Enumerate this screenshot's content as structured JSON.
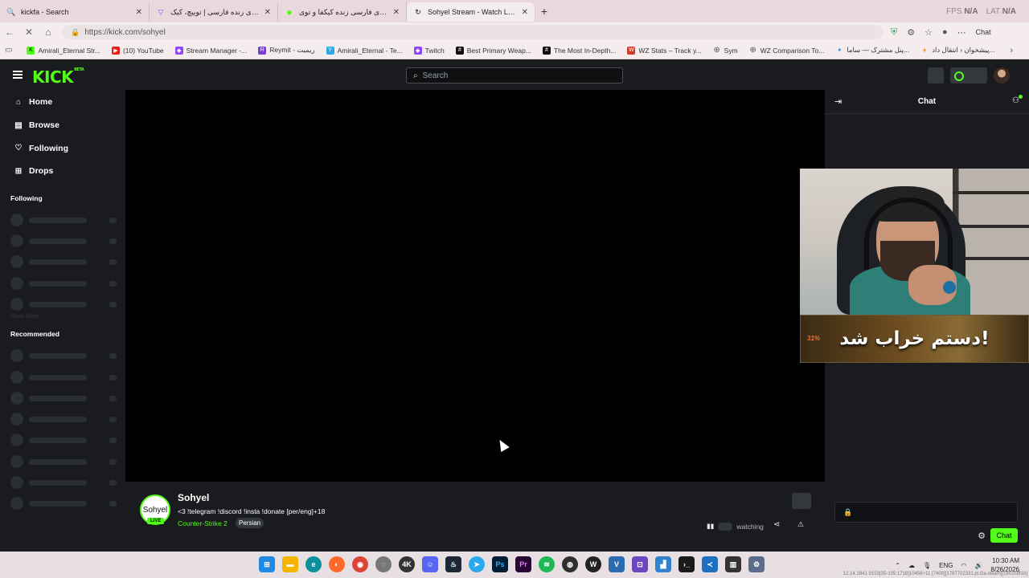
{
  "browser": {
    "tabs": [
      {
        "title": "kickfa - Search",
        "icon": "search-icon",
        "color": "#6a5acd"
      },
      {
        "title": "استریم‌های زنده فارسی | توییچ، کیک",
        "icon": "twitch-icon",
        "color": "#9146ff"
      },
      {
        "title": "استریمرهای فارسی زنده کیکفا و توی",
        "icon": "kickfa-icon",
        "color": "#53fc18"
      },
      {
        "title": "Sohyel Stream - Watch Live on Kick",
        "icon": "kick-icon",
        "color": "#53fc18"
      }
    ],
    "fps_label": "FPS",
    "fps_value": "N/A",
    "lat_label": "LAT",
    "lat_value": "N/A",
    "url": "https://kick.com/sohyel",
    "chat_label": "Chat",
    "bookmarks": [
      {
        "label": "Amirali_Eternal Str...",
        "color": "#53fc18",
        "icon": "K"
      },
      {
        "label": "(10) YouTube",
        "color": "#e62117",
        "icon": "▶"
      },
      {
        "label": "Stream Manager -...",
        "color": "#9146ff",
        "icon": "◆"
      },
      {
        "label": "Reymit - ریمیت",
        "color": "#7a3fd1",
        "icon": "R"
      },
      {
        "label": "Amirali_Eternal - Te...",
        "color": "#29a9eb",
        "icon": "Y"
      },
      {
        "label": "Twitch",
        "color": "#9146ff",
        "icon": "◆"
      },
      {
        "label": "Best Primary Weap...",
        "color": "#111111",
        "icon": "#"
      },
      {
        "label": "The Most In-Depth...",
        "color": "#111111",
        "icon": "#"
      },
      {
        "label": "WZ Stats – Track y...",
        "color": "#d23b2b",
        "icon": "W"
      },
      {
        "label": "Sym",
        "color": "#555555",
        "icon": "⊕"
      },
      {
        "label": "WZ Comparison To...",
        "color": "#555555",
        "icon": "⊕"
      },
      {
        "label": "پنل مشترک — ساما...",
        "color": "#2d8ff0",
        "icon": "●"
      },
      {
        "label": "پیشخوان ‹ انتقال داد...",
        "color": "#e07b00",
        "icon": "✈"
      }
    ]
  },
  "kick": {
    "logo": "KICK",
    "beta": "BETA",
    "search_placeholder": "Search",
    "nav": [
      {
        "label": "Home",
        "icon": "home-icon"
      },
      {
        "label": "Browse",
        "icon": "browse-icon"
      },
      {
        "label": "Following",
        "icon": "heart-icon"
      },
      {
        "label": "Drops",
        "icon": "drops-icon"
      }
    ],
    "following_title": "Following",
    "show_more": "Show More",
    "recommended_title": "Recommended",
    "accent": "#53fc18",
    "channel": {
      "avatar_text": "Sohyel",
      "live_badge": "LIVE",
      "name": "Sohyel",
      "title": "<3 !telegram !discord !insta !donate  [per/eng]+18",
      "category": "Counter-Strike 2",
      "tag": "Persian",
      "watching": "watching"
    },
    "chat": {
      "title": "Chat",
      "send_label": "Chat"
    },
    "overlay": {
      "banner_text": "دستم خراب شد!",
      "banner_percent": "31%"
    }
  },
  "taskbar": {
    "lang": "ENG",
    "time": "10:30 AM",
    "date": "8/26/2026",
    "overlay_stats": "12.14.2841 9153[35-105:1718]10458+11 [7400][1787702331.pl.Ga.steam][1901f3ff1b]"
  }
}
